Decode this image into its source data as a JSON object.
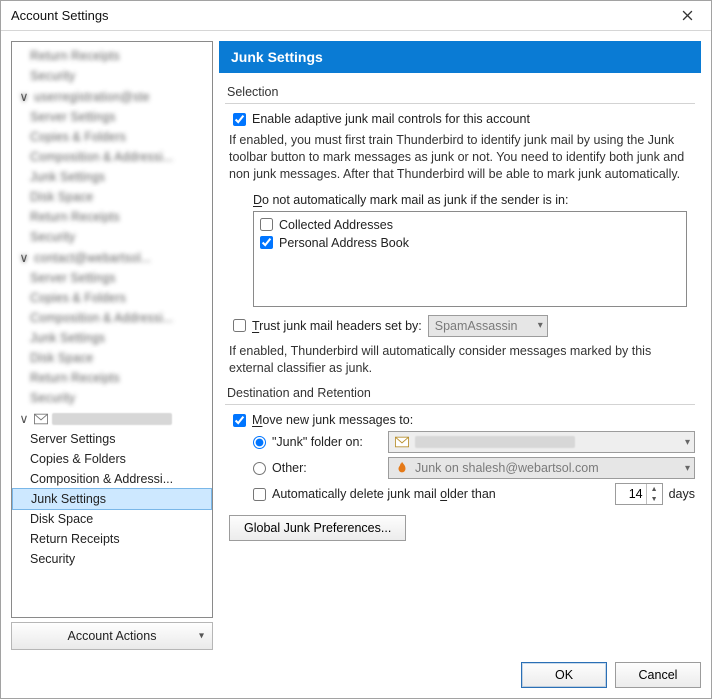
{
  "window": {
    "title": "Account Settings"
  },
  "sidebar": {
    "blurred_groups": [
      {
        "items": [
          "Return Receipts",
          "Security"
        ]
      },
      {
        "header": "userregistration@ste",
        "items": [
          "Server Settings",
          "Copies & Folders",
          "Composition & Addressi...",
          "Junk Settings",
          "Disk Space",
          "Return Receipts",
          "Security"
        ]
      },
      {
        "header": "contact@webartsol...",
        "items": [
          "Server Settings",
          "Copies & Folders",
          "Composition & Addressi...",
          "Junk Settings",
          "Disk Space",
          "Return Receipts",
          "Security"
        ]
      }
    ],
    "active_account_label": "",
    "items": [
      {
        "label": "Server Settings"
      },
      {
        "label": "Copies & Folders"
      },
      {
        "label": "Composition & Addressi..."
      },
      {
        "label": "Junk Settings",
        "selected": true
      },
      {
        "label": "Disk Space"
      },
      {
        "label": "Return Receipts"
      },
      {
        "label": "Security"
      }
    ],
    "account_actions": "Account Actions"
  },
  "panel": {
    "title": "Junk Settings",
    "selection_label": "Selection",
    "enable_adaptive": "Enable adaptive junk mail controls for this account",
    "enable_adaptive_checked": true,
    "adaptive_desc": "If enabled, you must first train Thunderbird to identify junk mail by using the Junk toolbar button to mark messages as junk or not. You need to identify both junk and non junk messages. After that Thunderbird will be able to mark junk automatically.",
    "whitelist_prefix": "D",
    "whitelist_rest": "o not automatically mark mail as junk if the sender is in:",
    "whitelist": [
      {
        "label": "Collected Addresses",
        "checked": false
      },
      {
        "label": "Personal Address Book",
        "checked": true
      }
    ],
    "trust_prefix": "T",
    "trust_rest": "rust junk mail headers set by:",
    "trust_checked": false,
    "trust_option": "SpamAssassin",
    "trust_desc": "If enabled, Thunderbird will automatically consider messages marked by this external classifier as junk.",
    "dest_label": "Destination and Retention",
    "move_prefix": "M",
    "move_rest": "ove new junk messages to:",
    "move_checked": true,
    "junk_folder_label": "\"Junk\" folder on:",
    "junk_folder_value": "",
    "other_label": "Other:",
    "other_value": "Junk on shalesh@webartsol.com",
    "auto_delete_label_pre": "Automatically delete junk mail ",
    "auto_delete_label_u": "o",
    "auto_delete_label_post": "lder than",
    "auto_delete_checked": false,
    "auto_delete_days": "14",
    "days_label": "days",
    "global_btn": "Global Junk Preferences...",
    "other_selected": false
  },
  "footer": {
    "ok": "OK",
    "cancel": "Cancel"
  }
}
